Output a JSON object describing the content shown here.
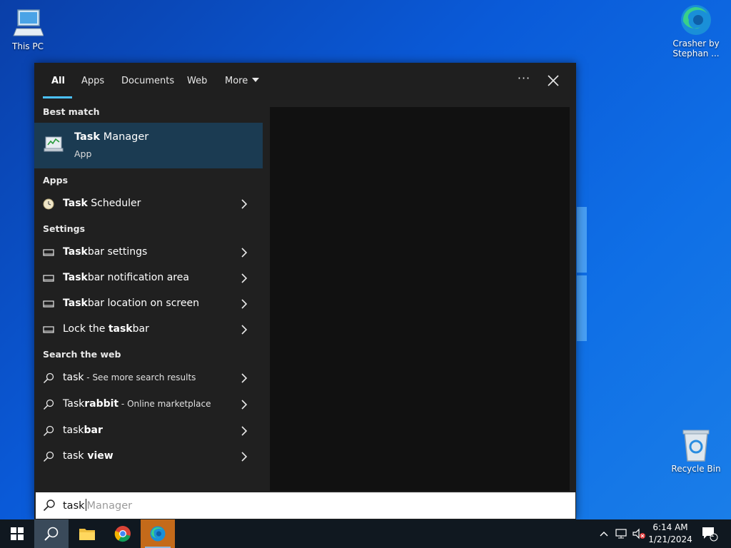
{
  "desktop": {
    "icons": [
      {
        "label": "This PC"
      },
      {
        "label": "Crasher by Stephan ..."
      },
      {
        "label": "Recycle Bin"
      }
    ]
  },
  "search": {
    "tabs": [
      {
        "label": "All",
        "active": true
      },
      {
        "label": "Apps"
      },
      {
        "label": "Documents"
      },
      {
        "label": "Web"
      },
      {
        "label": "More"
      }
    ],
    "ellipsis": "···",
    "best_match": {
      "header": "Best match",
      "title_bold": "Task",
      "title_rest": " Manager",
      "subtitle": "App"
    },
    "apps": {
      "header": "Apps",
      "items": [
        {
          "bold": "Task",
          "rest": " Scheduler"
        }
      ]
    },
    "settings": {
      "header": "Settings",
      "items": [
        {
          "pre": "",
          "bold": "Task",
          "rest": "bar settings"
        },
        {
          "pre": "",
          "bold": "Task",
          "rest": "bar notification area"
        },
        {
          "pre": "",
          "bold": "Task",
          "rest": "bar location on screen"
        },
        {
          "pre": "Lock the ",
          "bold": "task",
          "rest": "bar"
        }
      ]
    },
    "web": {
      "header": "Search the web",
      "items": [
        {
          "pre": "task",
          "bold": "",
          "rest": "",
          "small": " - See more search results"
        },
        {
          "pre": "Task",
          "bold": "rabbit",
          "rest": "",
          "small": " - Online marketplace"
        },
        {
          "pre": "task",
          "bold": "bar",
          "rest": "",
          "small": ""
        },
        {
          "pre": "task",
          "bold": " view",
          "rest": "",
          "small": ""
        }
      ]
    },
    "input": {
      "typed": "task",
      "suggestion": "Manager"
    }
  },
  "taskbar": {
    "time": "6:14 AM",
    "date": "1/21/2024",
    "notification_count": "1"
  },
  "colors": {
    "accent": "#4cc2ff",
    "best_match_bg": "#1b3b52",
    "panel_bg": "#202020"
  }
}
